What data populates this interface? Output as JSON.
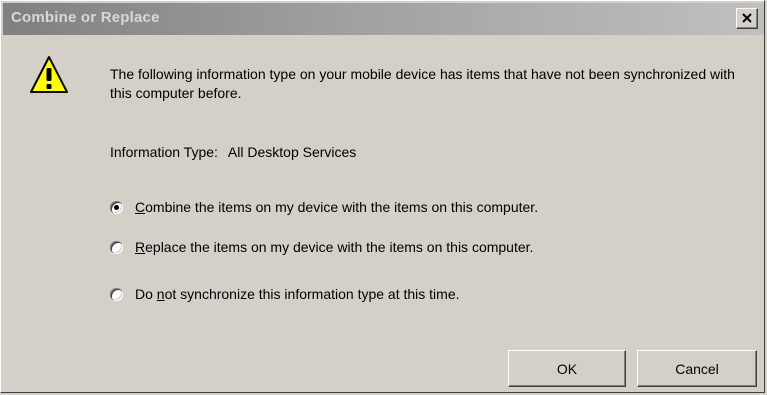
{
  "window": {
    "title": "Combine or Replace",
    "close_label": "close"
  },
  "icons": {
    "warning": "warning-icon",
    "close": "close-icon"
  },
  "message": "The following information type on your mobile device has items that have not been synchronized with this computer before.",
  "info": {
    "label": "Information Type:",
    "value": "All Desktop Services"
  },
  "options": [
    {
      "prefix": "",
      "accel": "C",
      "rest": "ombine the items on my device with the items on this computer.",
      "checked": true
    },
    {
      "prefix": "",
      "accel": "R",
      "rest": "eplace the items on my device with the items on this computer.",
      "checked": false
    },
    {
      "prefix": "Do ",
      "accel": "n",
      "rest": "ot synchronize this information type at this time.",
      "checked": false
    }
  ],
  "buttons": {
    "ok": "OK",
    "cancel": "Cancel"
  },
  "colors": {
    "face": "#d4d0c8",
    "title_gradient_start": "#808080",
    "warning_yellow": "#ffff00"
  }
}
